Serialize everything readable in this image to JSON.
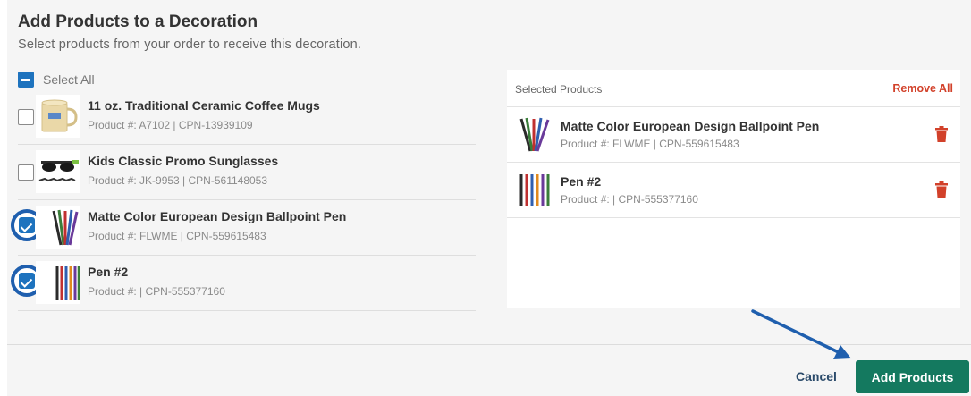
{
  "dialog": {
    "title": "Add Products to a Decoration",
    "subtitle": "Select products from your order to receive this decoration."
  },
  "left_list": {
    "select_all_label": "Select All",
    "products": [
      {
        "name": "11 oz. Traditional Ceramic Coffee Mugs",
        "meta": "Product #: A7102 | CPN-13939109",
        "checked": false,
        "thumb_icon": "mug-icon"
      },
      {
        "name": "Kids Classic Promo Sunglasses",
        "meta": "Product #: JK-9953 | CPN-561148053",
        "checked": false,
        "thumb_icon": "sunglasses-icon"
      },
      {
        "name": "Matte Color European Design Ballpoint Pen",
        "meta": "Product #: FLWME | CPN-559615483",
        "checked": true,
        "thumb_icon": "pens-icon"
      },
      {
        "name": "Pen #2",
        "meta": "Product #:  | CPN-555377160",
        "checked": true,
        "thumb_icon": "pens-icon"
      }
    ]
  },
  "selected_panel": {
    "title": "Selected Products",
    "remove_all_label": "Remove All",
    "items": [
      {
        "name": "Matte Color European Design Ballpoint Pen",
        "meta": "Product #: FLWME | CPN-559615483"
      },
      {
        "name": "Pen #2",
        "meta": "Product #:  | CPN-555377160"
      }
    ]
  },
  "footer": {
    "cancel_label": "Cancel",
    "add_label": "Add Products"
  },
  "colors": {
    "accent_blue": "#1e73be",
    "danger_red": "#d2412a",
    "primary_green": "#14795f",
    "annotation_arrow": "#1f5fae"
  }
}
